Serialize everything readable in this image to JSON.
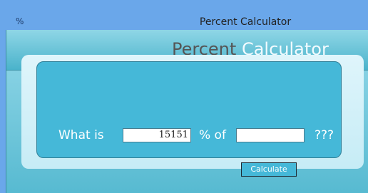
{
  "window": {
    "title": "Percent Calculator",
    "icon": "calculator-percent-icon"
  },
  "header": {
    "word1": "Percent",
    "word2": "Calculator"
  },
  "form": {
    "prefix_label": "What is",
    "percent_value": "15151",
    "middle_label": "% of",
    "base_value": "",
    "suffix_label": "???",
    "calculate_label": "Calculate"
  },
  "colors": {
    "titlebar": "#6aa7ea",
    "panel": "#45b8d8",
    "text_light": "#ffffff"
  }
}
